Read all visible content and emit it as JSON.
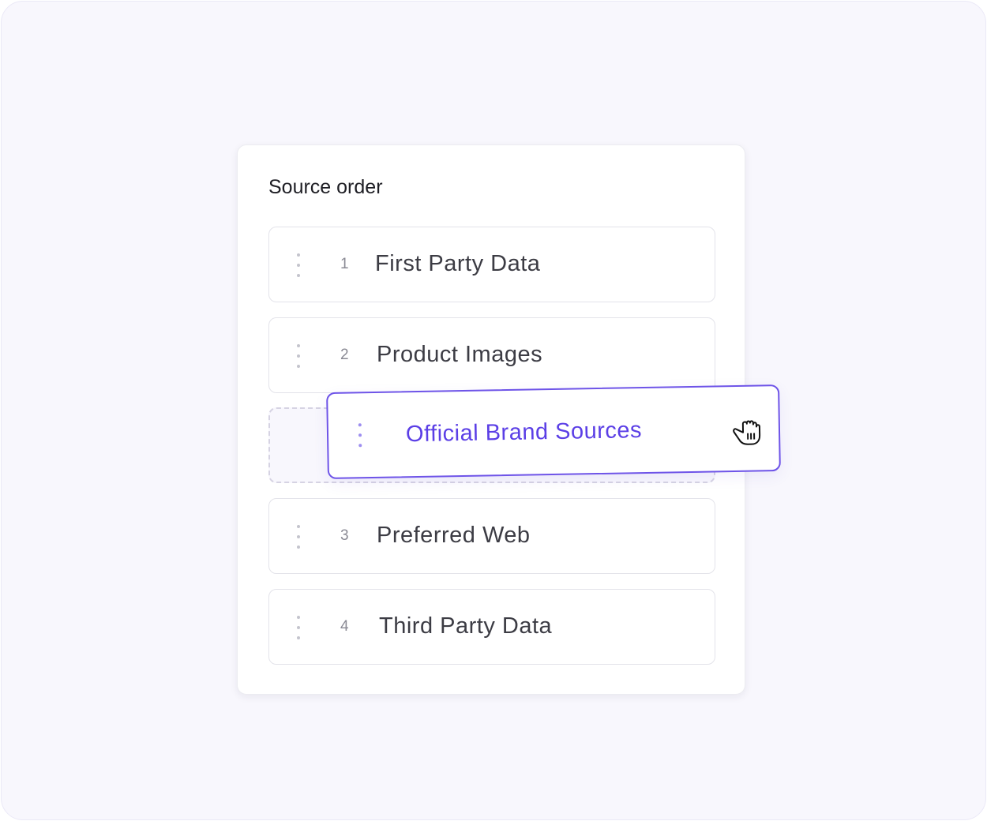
{
  "panel": {
    "title": "Source order"
  },
  "sources": [
    {
      "rank": "1",
      "label": "First Party Data"
    },
    {
      "rank": "2",
      "label": "Product Images"
    },
    {
      "rank": "3",
      "label": "Preferred Web"
    },
    {
      "rank": "4",
      "label": "Third Party Data"
    }
  ],
  "dragging": {
    "label": "Official Brand Sources",
    "cursor_icon": "grab-hand-icon"
  },
  "colors": {
    "accent": "#6e54e8",
    "accent_text": "#5b3fe6",
    "background": "#f8f7fd"
  }
}
